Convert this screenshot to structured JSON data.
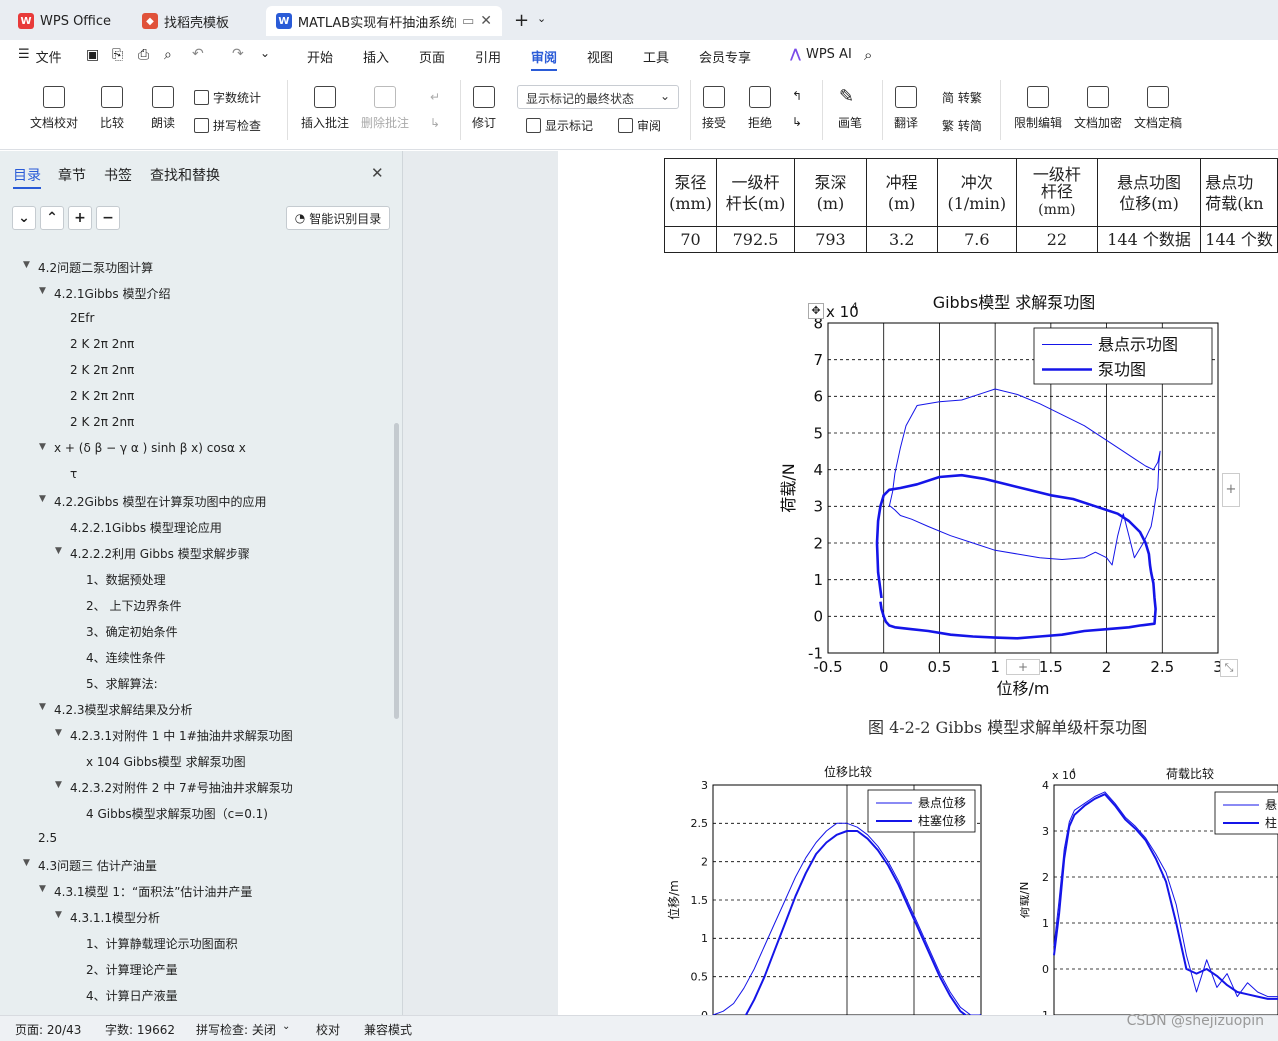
{
  "tabs": [
    {
      "label": "WPS Office"
    },
    {
      "label": "找稻壳模板"
    },
    {
      "label": "MATLAB实现有杆抽油系统的"
    }
  ],
  "menu": {
    "file": "文件",
    "items": [
      "开始",
      "插入",
      "页面",
      "引用",
      "审阅",
      "视图",
      "工具",
      "会员专享"
    ],
    "active": "审阅",
    "ai": "WPS AI"
  },
  "ribbon": {
    "proofread": "文档校对",
    "compare": "比较",
    "read_aloud": "朗读",
    "word_count": "字数统计",
    "spell_check": "拼写检查",
    "insert_comment": "插入批注",
    "delete_comment": "删除批注",
    "revise": "修订",
    "markup_select": "显示标记的最终状态",
    "show_markup": "显示标记",
    "review": "审阅",
    "accept": "接受",
    "reject": "拒绝",
    "pen": "画笔",
    "translate": "翻译",
    "to_traditional": "简 转繁",
    "to_simplified": "繁 转简",
    "restrict_edit": "限制编辑",
    "encrypt": "文档加密",
    "finalize": "文档定稿"
  },
  "sidebar": {
    "tabs": [
      "目录",
      "章节",
      "书签",
      "查找和替换"
    ],
    "smart_button": "智能识别目录",
    "toc": [
      {
        "label": "4.2问题二泵功图计算",
        "level": 1,
        "arrow": true
      },
      {
        "label": "4.2.1Gibbs 模型介绍",
        "level": 2,
        "arrow": true
      },
      {
        "label": "2Efr",
        "level": 3,
        "arrow": false
      },
      {
        "label": "2  K  2π  2nπ",
        "level": 3,
        "arrow": false
      },
      {
        "label": "2  K  2π  2nπ",
        "level": 3,
        "arrow": false
      },
      {
        "label": "2  K  2π  2nπ",
        "level": 3,
        "arrow": false
      },
      {
        "label": "2  K  2π  2nπ",
        "level": 3,
        "arrow": false
      },
      {
        "label": "x + (δ β − γ α ) sinh β x) cosα x",
        "level": 2,
        "arrow": true
      },
      {
        "label": "τ",
        "level": 3,
        "arrow": false
      },
      {
        "label": "4.2.2Gibbs 模型在计算泵功图中的应用",
        "level": 2,
        "arrow": true
      },
      {
        "label": "4.2.2.1Gibbs 模型理论应用",
        "level": 3,
        "arrow": false
      },
      {
        "label": "4.2.2.2利用 Gibbs 模型求解步骤",
        "level": 3,
        "arrow": true
      },
      {
        "label": "1、数据预处理",
        "level": 4,
        "arrow": false
      },
      {
        "label": "2、 上下边界条件",
        "level": 4,
        "arrow": false
      },
      {
        "label": "3、确定初始条件",
        "level": 4,
        "arrow": false
      },
      {
        "label": "4、连续性条件",
        "level": 4,
        "arrow": false
      },
      {
        "label": "5、求解算法:",
        "level": 4,
        "arrow": false
      },
      {
        "label": "4.2.3模型求解结果及分析",
        "level": 2,
        "arrow": true
      },
      {
        "label": "4.2.3.1对附件 1 中 1#抽油井求解泵功图",
        "level": 3,
        "arrow": true
      },
      {
        "label": "x 104 Gibbs模型  求解泵功图",
        "level": 4,
        "arrow": false
      },
      {
        "label": "4.2.3.2对附件 2 中 7#号抽油井求解泵功",
        "level": 3,
        "arrow": true
      },
      {
        "label": "4 Gibbs模型求解泵功图（c=0.1)",
        "level": 4,
        "arrow": false
      },
      {
        "label": "2.5",
        "level": 0,
        "arrow": false
      },
      {
        "label": "4.3问题三 估计产油量",
        "level": 1,
        "arrow": true
      },
      {
        "label": "4.3.1模型 1：“面积法”估计油井产量",
        "level": 2,
        "arrow": true
      },
      {
        "label": "4.3.1.1模型分析",
        "level": 3,
        "arrow": true
      },
      {
        "label": "1、计算静载理论示功图面积",
        "level": 4,
        "arrow": false
      },
      {
        "label": "2、计算理论产量",
        "level": 4,
        "arrow": false
      },
      {
        "label": "4、计算日产液量",
        "level": 4,
        "arrow": false
      }
    ]
  },
  "table": {
    "headers": [
      [
        "泵径",
        "(mm)"
      ],
      [
        "一级杆",
        "杆长(m)"
      ],
      [
        "泵深",
        "(m)"
      ],
      [
        "冲程",
        "(m)"
      ],
      [
        "冲次",
        "(1/min)"
      ],
      [
        "一级杆",
        "杆径",
        "(mm)"
      ],
      [
        "悬点功图",
        "位移(m)"
      ],
      [
        "悬点功",
        "荷载(kn"
      ]
    ],
    "row": [
      "70",
      "792.5",
      "793",
      "3.2",
      "7.6",
      "22",
      "144 个数据",
      "144 个数"
    ]
  },
  "caption": "图 4-2-2   Gibbs 模型求解单级杆泵功图",
  "chart_data": [
    {
      "type": "line",
      "title": "Gibbs模型  求解泵功图",
      "xlabel": "位移/m",
      "ylabel": "荷载/N",
      "y_multiplier": "x 10",
      "y_exponent": "4",
      "xlim": [
        -0.5,
        3
      ],
      "ylim": [
        -1,
        8
      ],
      "xticks": [
        "-0.5",
        "0",
        "0.5",
        "1",
        "1.5",
        "2",
        "2.5",
        "3"
      ],
      "yticks": [
        "-1",
        "0",
        "1",
        "2",
        "3",
        "4",
        "5",
        "6",
        "7",
        "8"
      ],
      "legend_position": "top-right",
      "grid": true,
      "series": [
        {
          "name": "悬点示功图",
          "color": "#1515e8",
          "width": 1,
          "x": [
            0.05,
            0.08,
            0.1,
            0.15,
            0.2,
            0.3,
            0.5,
            0.7,
            0.9,
            1.0,
            1.2,
            1.4,
            1.6,
            1.8,
            2.0,
            2.15,
            2.25,
            2.35,
            2.42,
            2.46,
            2.48,
            2.47,
            2.46,
            2.44,
            2.42,
            2.4,
            2.33,
            2.25,
            2.2,
            2.15,
            2.1,
            2.05,
            2.0,
            1.9,
            1.8,
            1.6,
            1.4,
            1.2,
            1.0,
            0.8,
            0.6,
            0.4,
            0.25,
            0.15,
            0.1,
            0.06,
            0.05
          ],
          "y": [
            3.0,
            3.4,
            3.9,
            4.6,
            5.2,
            5.75,
            5.85,
            5.9,
            6.1,
            6.2,
            6.05,
            5.8,
            5.5,
            5.2,
            4.8,
            4.5,
            4.3,
            4.1,
            4.0,
            4.2,
            4.5,
            4.2,
            3.5,
            3.2,
            2.8,
            2.45,
            2.0,
            1.6,
            2.2,
            2.8,
            2.2,
            1.4,
            1.6,
            1.75,
            1.6,
            1.55,
            1.6,
            1.7,
            1.8,
            2.0,
            2.2,
            2.45,
            2.65,
            2.75,
            2.9,
            3.0,
            3.0
          ]
        },
        {
          "name": "泵功图",
          "color": "#1515e8",
          "width": 2.6,
          "x": [
            -0.02,
            -0.05,
            -0.06,
            -0.05,
            -0.03,
            0.0,
            0.05,
            0.15,
            0.3,
            0.5,
            0.7,
            0.9,
            1.1,
            1.3,
            1.5,
            1.7,
            1.9,
            2.1,
            2.2,
            2.3,
            2.35,
            2.38,
            2.39,
            2.4,
            2.42,
            2.43,
            2.44,
            2.43,
            2.3,
            2.2,
            2.0,
            1.8,
            1.6,
            1.4,
            1.2,
            1.0,
            0.8,
            0.6,
            0.4,
            0.25,
            0.1,
            0.05,
            0.02,
            0.0,
            -0.02,
            -0.03
          ],
          "y": [
            0.5,
            1.2,
            2.0,
            2.6,
            3.0,
            3.3,
            3.45,
            3.5,
            3.6,
            3.8,
            3.85,
            3.75,
            3.6,
            3.45,
            3.3,
            3.2,
            3.0,
            2.8,
            2.6,
            2.3,
            2.0,
            1.7,
            1.4,
            1.2,
            0.9,
            0.5,
            0.2,
            -0.2,
            -0.25,
            -0.3,
            -0.35,
            -0.4,
            -0.5,
            -0.55,
            -0.6,
            -0.58,
            -0.55,
            -0.5,
            -0.4,
            -0.35,
            -0.3,
            -0.25,
            -0.15,
            0.0,
            0.2,
            0.4
          ]
        }
      ]
    },
    {
      "type": "line",
      "title": "位移比较",
      "ylabel": "位移/m",
      "ylim": [
        0,
        3
      ],
      "yticks": [
        "0",
        "0.5",
        "1",
        "1.5",
        "2",
        "2.5",
        "3"
      ],
      "legend_position": "top-right",
      "grid": true,
      "series": [
        {
          "name": "悬点位移",
          "color": "#1515e8",
          "width": 1,
          "x": [
            0,
            10,
            20,
            30,
            40,
            50,
            60,
            70,
            80,
            90,
            100,
            110,
            120,
            130,
            140,
            150,
            160,
            170,
            180,
            190,
            200,
            210,
            220,
            230,
            240,
            250,
            260
          ],
          "y": [
            0,
            0.05,
            0.15,
            0.35,
            0.6,
            0.9,
            1.2,
            1.5,
            1.8,
            2.05,
            2.25,
            2.4,
            2.5,
            2.5,
            2.45,
            2.35,
            2.2,
            2.0,
            1.75,
            1.45,
            1.15,
            0.85,
            0.55,
            0.3,
            0.1,
            0.0,
            0.0
          ]
        },
        {
          "name": "柱塞位移",
          "color": "#1515e8",
          "width": 2,
          "x": [
            0,
            10,
            20,
            30,
            40,
            50,
            60,
            70,
            80,
            90,
            100,
            110,
            120,
            130,
            140,
            150,
            160,
            170,
            180,
            190,
            200,
            210,
            220,
            230,
            240,
            250,
            260
          ],
          "y": [
            0,
            -0.1,
            -0.15,
            -0.05,
            0.2,
            0.5,
            0.85,
            1.2,
            1.55,
            1.85,
            2.1,
            2.25,
            2.35,
            2.4,
            2.4,
            2.3,
            2.15,
            1.95,
            1.7,
            1.4,
            1.1,
            0.8,
            0.5,
            0.25,
            0.05,
            -0.05,
            0.0
          ]
        }
      ]
    },
    {
      "type": "line",
      "title": "荷载比较",
      "ylabel": "荷载/N",
      "y_multiplier": "x 10",
      "y_exponent": "4",
      "ylim": [
        -1,
        4
      ],
      "yticks": [
        "-1",
        "0",
        "1",
        "2",
        "3",
        "4"
      ],
      "legend_position": "top-right",
      "grid": true,
      "series": [
        {
          "name": "悬",
          "color": "#1515e8",
          "width": 1,
          "x": [
            0,
            5,
            10,
            15,
            20,
            30,
            40,
            50,
            60,
            70,
            80,
            90,
            100,
            110,
            120,
            130,
            140,
            150,
            160,
            170,
            180,
            190,
            200,
            210,
            220
          ],
          "y": [
            0.5,
            1.5,
            2.6,
            3.2,
            3.45,
            3.6,
            3.75,
            3.85,
            3.6,
            3.3,
            3.1,
            2.85,
            2.5,
            2.1,
            1.4,
            0.3,
            -0.5,
            0.2,
            -0.4,
            -0.1,
            -0.6,
            -0.3,
            -0.5,
            -0.6,
            -0.6
          ]
        },
        {
          "name": "柱",
          "color": "#1515e8",
          "width": 2,
          "x": [
            0,
            5,
            10,
            15,
            20,
            30,
            40,
            50,
            60,
            70,
            80,
            90,
            100,
            110,
            120,
            130,
            140,
            150,
            160,
            170,
            180,
            190,
            200,
            210,
            220
          ],
          "y": [
            0.3,
            1.2,
            2.4,
            3.1,
            3.35,
            3.55,
            3.7,
            3.8,
            3.55,
            3.25,
            3.05,
            2.8,
            2.4,
            1.9,
            1.0,
            0.0,
            -0.1,
            0.0,
            -0.15,
            -0.35,
            -0.5,
            -0.55,
            -0.6,
            -0.65,
            -0.65
          ]
        }
      ]
    }
  ],
  "status": {
    "page": "页面: 20/43",
    "words": "字数: 19662",
    "spell": "拼写检查: 关闭",
    "proof": "校对",
    "compat": "兼容模式"
  },
  "watermark": "CSDN @shejizuopin",
  "colors": {
    "accent": "#2a5bd7",
    "curve": "#1515e8"
  }
}
